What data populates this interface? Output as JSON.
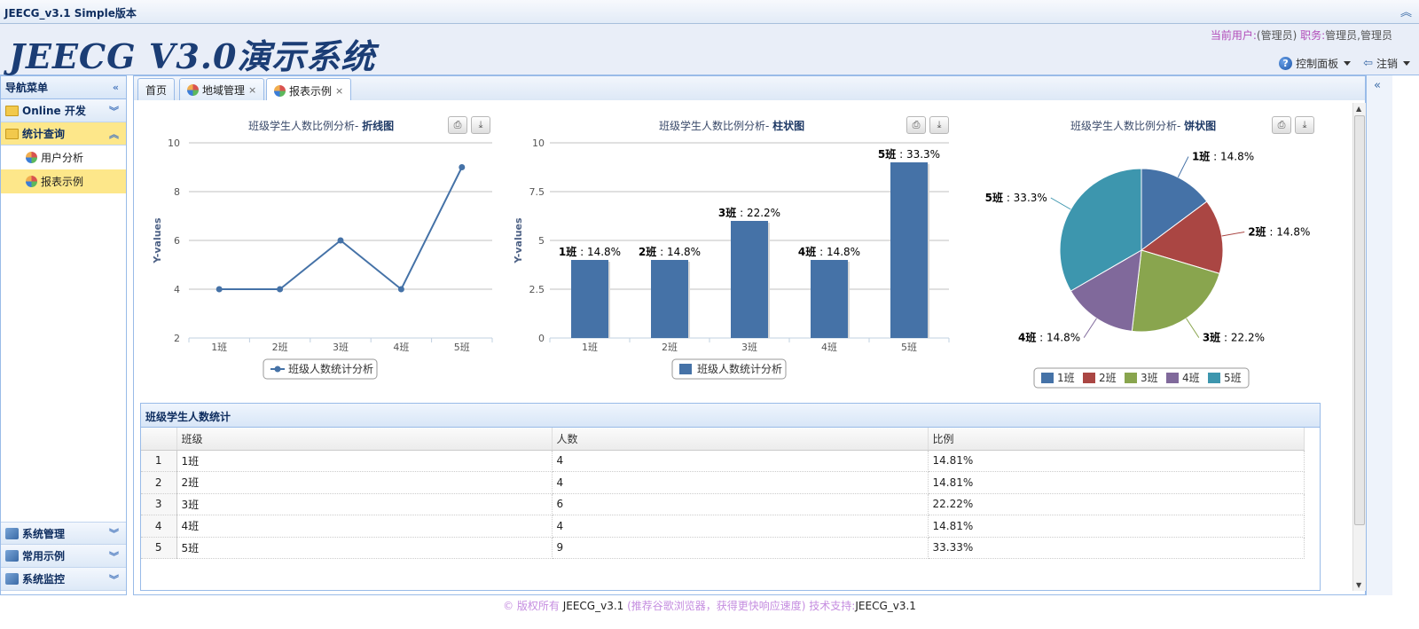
{
  "window": {
    "title": "JEECG_v3.1 Simple版本"
  },
  "header": {
    "logo": "JEECG  V3.0演示系统",
    "user_label": "当前用户:",
    "user_value": "(管理员)",
    "role_label": "职务:",
    "role_value": "管理员,管理员",
    "control_panel": "控制面板",
    "logout": "注销"
  },
  "sidebar": {
    "title": "导航菜单",
    "groups": [
      {
        "label": "Online 开发"
      },
      {
        "label": "统计查询"
      }
    ],
    "items": [
      {
        "label": "用户分析"
      },
      {
        "label": "报表示例"
      }
    ],
    "bottom_groups": [
      {
        "label": "系统管理"
      },
      {
        "label": "常用示例"
      },
      {
        "label": "系统监控"
      }
    ]
  },
  "tabs": [
    {
      "label": "首页"
    },
    {
      "label": "地域管理"
    },
    {
      "label": "报表示例"
    }
  ],
  "charts": {
    "line_title_prefix": "班级学生人数比例分析-",
    "line_title_suffix": "折线图",
    "bar_title_prefix": "班级学生人数比例分析-",
    "bar_title_suffix": "柱状图",
    "pie_title_prefix": "班级学生人数比例分析-",
    "pie_title_suffix": "饼状图"
  },
  "chart_data": [
    {
      "type": "line",
      "title": "班级学生人数比例分析- 折线图",
      "categories": [
        "1班",
        "2班",
        "3班",
        "4班",
        "5班"
      ],
      "series": [
        {
          "name": "班级人数统计分析",
          "values": [
            4,
            4,
            6,
            4,
            9
          ]
        }
      ],
      "ylabel": "Y-values",
      "ylim": [
        2,
        10
      ],
      "yticks": [
        2,
        4,
        6,
        8,
        10
      ],
      "color": "#4572a7",
      "grid": true,
      "legend": "bottom"
    },
    {
      "type": "bar",
      "title": "班级学生人数比例分析- 柱状图",
      "categories": [
        "1班",
        "2班",
        "3班",
        "4班",
        "5班"
      ],
      "series": [
        {
          "name": "班级人数统计分析",
          "values": [
            4,
            4,
            6,
            4,
            9
          ]
        }
      ],
      "data_labels": [
        "1班 : 14.8%",
        "2班 : 14.8%",
        "3班 : 22.2%",
        "4班 : 14.8%",
        "5班 : 33.3%"
      ],
      "ylabel": "Y-values",
      "ylim": [
        0,
        10
      ],
      "yticks": [
        "0",
        "2.5",
        "5",
        "7.5",
        "10"
      ],
      "color": "#4572a7",
      "grid": true,
      "legend": "bottom"
    },
    {
      "type": "pie",
      "title": "班级学生人数比例分析- 饼状图",
      "categories": [
        "1班",
        "2班",
        "3班",
        "4班",
        "5班"
      ],
      "values": [
        14.8,
        14.8,
        22.2,
        14.8,
        33.3
      ],
      "data_labels": [
        "1班 : 14.8%",
        "2班 : 14.8%",
        "3班 : 22.2%",
        "4班 : 14.8%",
        "5班 : 33.3%"
      ],
      "colors": [
        "#4572a7",
        "#aa4643",
        "#89a54e",
        "#80699b",
        "#3d96ae"
      ],
      "legend": "bottom"
    }
  ],
  "grid": {
    "title": "班级学生人数统计",
    "columns": [
      "班级",
      "人数",
      "比例"
    ],
    "rows": [
      {
        "rn": "1",
        "cells": [
          "1班",
          "4",
          "14.81%"
        ]
      },
      {
        "rn": "2",
        "cells": [
          "2班",
          "4",
          "14.81%"
        ]
      },
      {
        "rn": "3",
        "cells": [
          "3班",
          "6",
          "22.22%"
        ]
      },
      {
        "rn": "4",
        "cells": [
          "4班",
          "4",
          "14.81%"
        ]
      },
      {
        "rn": "5",
        "cells": [
          "5班",
          "9",
          "33.33%"
        ]
      }
    ]
  },
  "footer": {
    "copyright": "© 版权所有",
    "app": "JEECG_v3.1",
    "hint": "(推荐谷歌浏览器，获得更快响应速度) 技术支持:",
    "support": "JEECG_v3.1"
  }
}
